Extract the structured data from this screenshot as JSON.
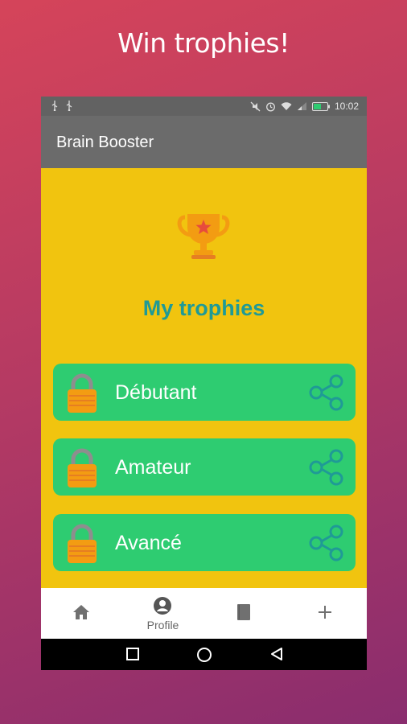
{
  "promo": {
    "title": "Win trophies!"
  },
  "status_bar": {
    "time": "10:02"
  },
  "app": {
    "title": "Brain Booster"
  },
  "trophies": {
    "title": "My trophies",
    "items": [
      {
        "label": "Débutant",
        "locked": true
      },
      {
        "label": "Amateur",
        "locked": true
      },
      {
        "label": "Avancé",
        "locked": true
      }
    ]
  },
  "bottom_nav": {
    "items": [
      {
        "icon": "home-icon",
        "label": ""
      },
      {
        "icon": "profile-icon",
        "label": "Profile"
      },
      {
        "icon": "book-icon",
        "label": ""
      },
      {
        "icon": "plus-icon",
        "label": ""
      }
    ]
  },
  "colors": {
    "background_top": "#d5445a",
    "background_bottom": "#8a2d6e",
    "content_bg": "#f1c40f",
    "app_bar": "#6b6b6b",
    "row_green": "#2ecc71",
    "title_teal": "#1f9a96",
    "trophy_orange": "#f39c12"
  }
}
